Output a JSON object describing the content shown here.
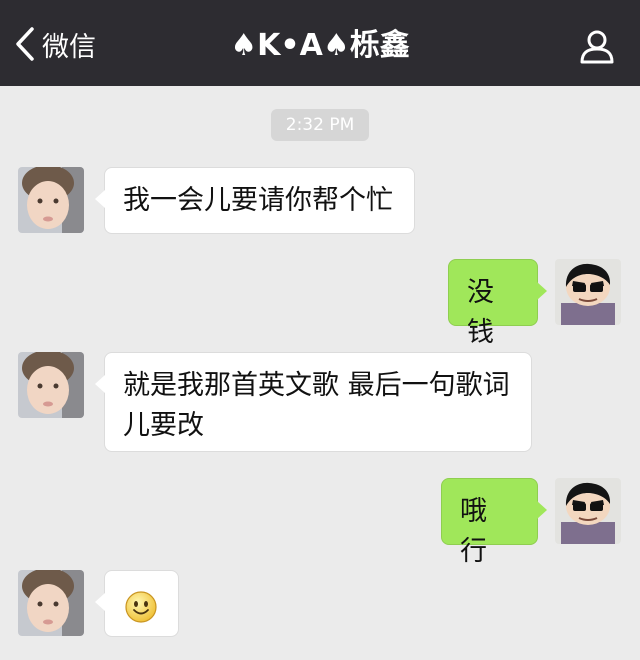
{
  "nav": {
    "back_label": "微信",
    "title": "♠K•A♠栎鑫"
  },
  "timestamp": "2:32 PM",
  "messages": [
    {
      "side": "in",
      "text": "我一会儿要请你帮个忙"
    },
    {
      "side": "out",
      "text": "没钱"
    },
    {
      "side": "in",
      "text": "就是我那首英文歌 最后一句歌词儿要改"
    },
    {
      "side": "out",
      "text": "哦 行"
    },
    {
      "side": "in",
      "emoji": "smile-emoji"
    }
  ],
  "colors": {
    "navbar": "#2d2c31",
    "background": "#ebebeb",
    "bubble_in": "#ffffff",
    "bubble_out": "#a0e75a"
  }
}
